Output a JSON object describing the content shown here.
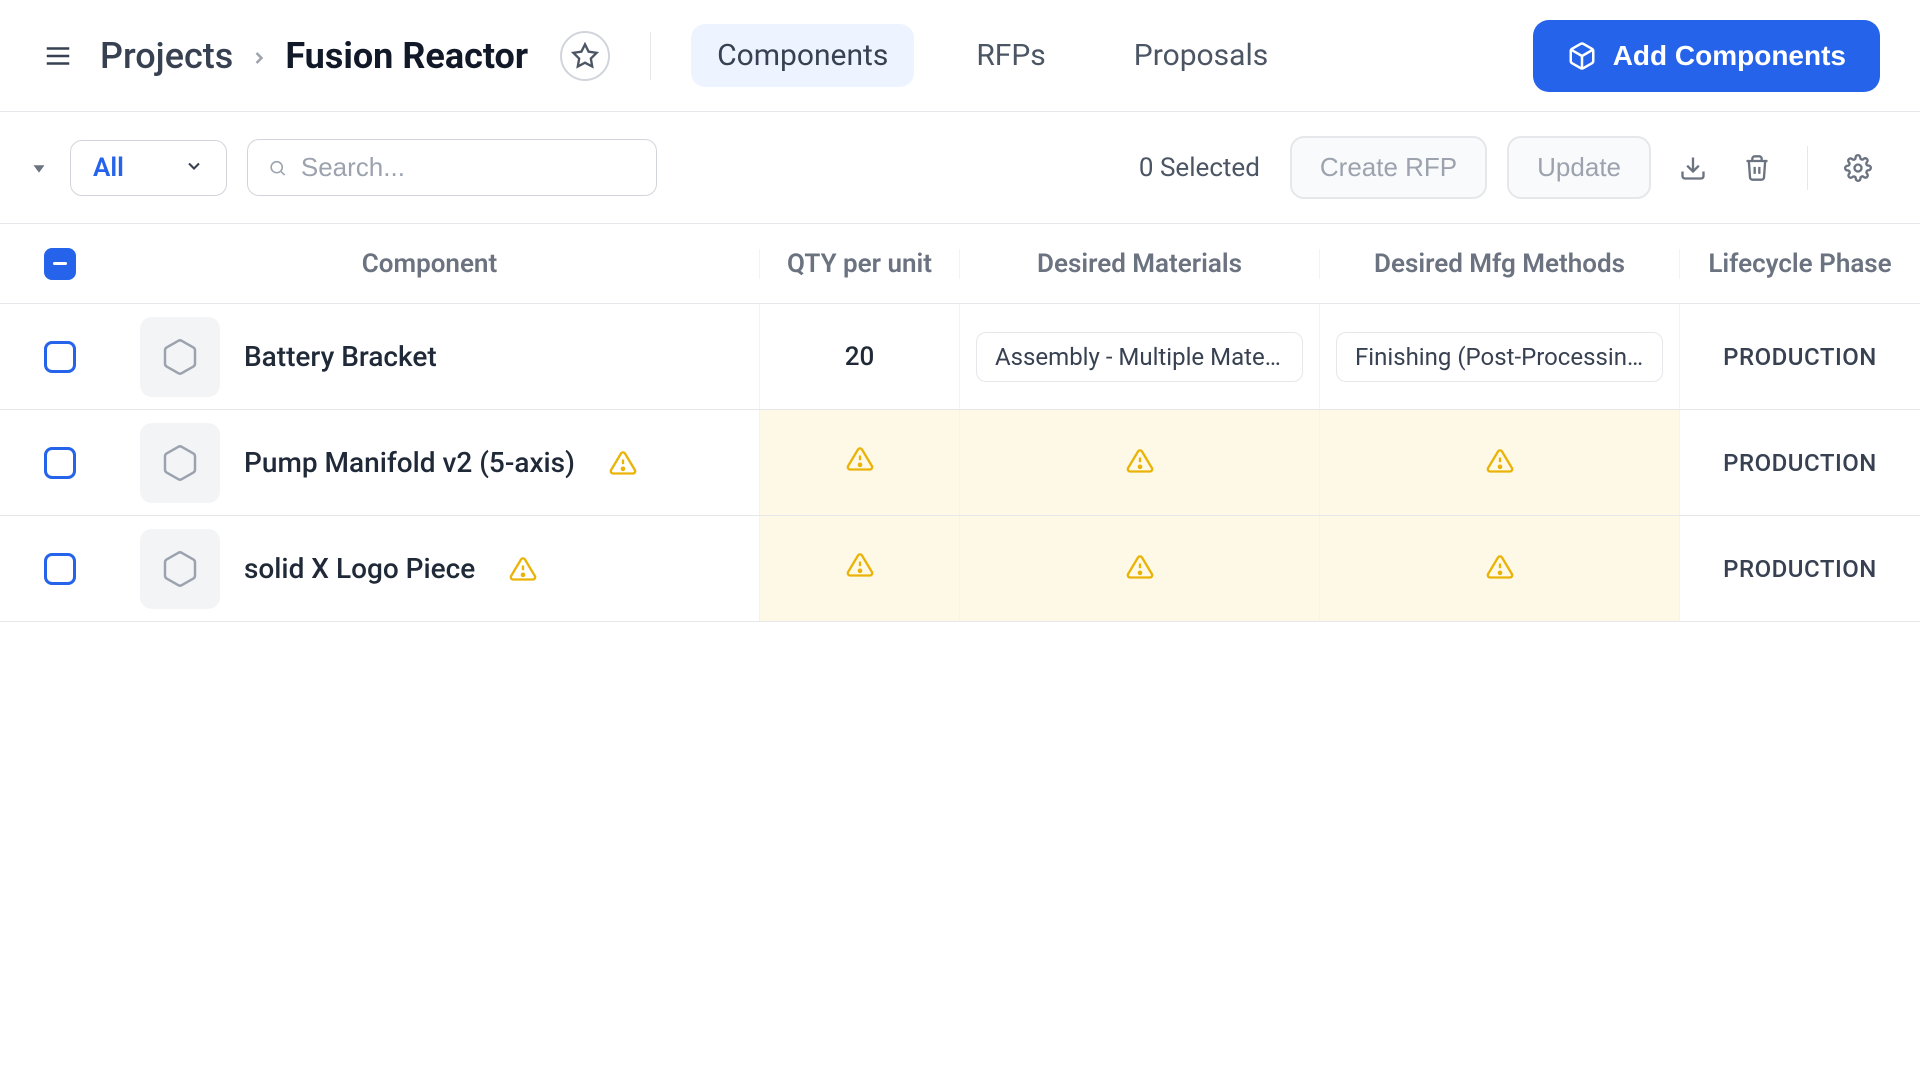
{
  "header": {
    "breadcrumb_root": "Projects",
    "project_title": "Fusion Reactor",
    "tabs": [
      {
        "label": "Components",
        "active": true
      },
      {
        "label": "RFPs",
        "active": false
      },
      {
        "label": "Proposals",
        "active": false
      }
    ],
    "add_button": "Add Components"
  },
  "toolbar": {
    "filter_label": "All",
    "search_placeholder": "Search...",
    "selected_text": "0 Selected",
    "create_rfp": "Create RFP",
    "update": "Update"
  },
  "columns": {
    "component": "Component",
    "qty": "QTY per unit",
    "materials": "Desired Materials",
    "methods": "Desired Mfg Methods",
    "lifecycle": "Lifecycle Phase"
  },
  "rows": [
    {
      "name": "Battery Bracket",
      "name_has_warning": false,
      "qty": "20",
      "materials": "Assembly - Multiple Materials",
      "methods": "Finishing (Post-Processing)",
      "lifecycle": "PRODUCTION",
      "warn_qty": false,
      "warn_materials": false,
      "warn_methods": false
    },
    {
      "name": "Pump Manifold v2 (5-axis)",
      "name_has_warning": true,
      "qty": "",
      "materials": "",
      "methods": "",
      "lifecycle": "PRODUCTION",
      "warn_qty": true,
      "warn_materials": true,
      "warn_methods": true
    },
    {
      "name": "solid X Logo Piece",
      "name_has_warning": true,
      "qty": "",
      "materials": "",
      "methods": "",
      "lifecycle": "PRODUCTION",
      "warn_qty": true,
      "warn_materials": true,
      "warn_methods": true
    }
  ]
}
